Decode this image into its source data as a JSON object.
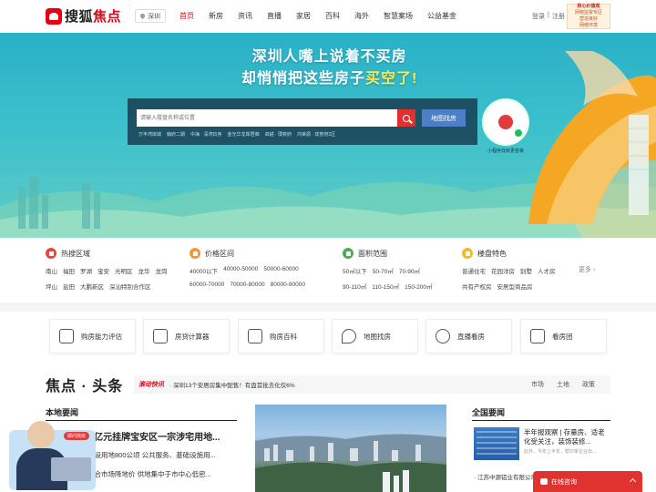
{
  "nav": {
    "logo_prefix": "搜狐",
    "logo_suffix": "焦点",
    "city": "深圳",
    "menu": [
      "首页",
      "新房",
      "资讯",
      "直播",
      "家居",
      "百科",
      "海外",
      "智慧案场",
      "公益基金"
    ],
    "active_menu": "首页",
    "login": "登录",
    "separator": "|",
    "register": "注册",
    "ad_badge_lines": [
      "核心价值观",
      "网络监督专区",
      "营造良好",
      "网络环境"
    ]
  },
  "banner": {
    "headline_line1": "深圳人嘴上说着不买房",
    "headline_line2_pre": "却悄悄把这些房子",
    "headline_line2_highlight": "买空了!",
    "search_placeholder": "请输入楼盘名称或位置",
    "map_button": "地图找房",
    "hot_tags": [
      "万丰湾岸城",
      "翰府二期",
      "中海 · 深湾玖序",
      "金光华龙岸君御",
      "卓越 · 璞奕府",
      "鸿荣源 · 珑誉府2区"
    ],
    "qr_caption": "小程序找房更容易"
  },
  "filters": [
    {
      "title": "热搜区域",
      "icon": "fire-icon",
      "color": "#e8473a",
      "rows": [
        [
          "南山",
          "福田",
          "罗湖",
          "宝安",
          "光明区",
          "龙华",
          "龙岗"
        ],
        [
          "坪山",
          "盐田",
          "大鹏新区",
          "深汕特别合作区"
        ]
      ]
    },
    {
      "title": "价格区间",
      "icon": "price-icon",
      "color": "#f39a2b",
      "rows": [
        [
          "40000以下",
          "40000-50000",
          "50000-60000"
        ],
        [
          "60000-70000",
          "70000-80000",
          "80000-90000"
        ]
      ]
    },
    {
      "title": "面积范围",
      "icon": "area-icon",
      "color": "#4caf50",
      "rows": [
        [
          "50㎡以下",
          "50-70㎡",
          "70-90㎡"
        ],
        [
          "90-110㎡",
          "110-150㎡",
          "150-200㎡"
        ]
      ]
    },
    {
      "title": "楼盘特色",
      "icon": "feature-icon",
      "color": "#f3b82b",
      "rows": [
        [
          "普通住宅",
          "花园洋房",
          "别墅",
          "人才房"
        ],
        [
          "共有产权房",
          "安居型商品房"
        ]
      ]
    }
  ],
  "filters_more": "更多 ›",
  "tools": [
    {
      "label": "购房能力评估",
      "icon": "house-check-icon"
    },
    {
      "label": "房贷计算器",
      "icon": "calculator-icon"
    },
    {
      "label": "购房百科",
      "icon": "book-icon"
    },
    {
      "label": "地图找房",
      "icon": "map-pin-icon"
    },
    {
      "label": "直播看房",
      "icon": "play-icon"
    },
    {
      "label": "看房团",
      "icon": "group-icon"
    }
  ],
  "news": {
    "title": "焦点 · 头条",
    "ticker_tag": "滚动快讯",
    "ticker_text": "· 深圳13个安居房集中配售！有盘首批去化仅6%",
    "ticker_tabs": [
      "市场",
      "土地",
      "政策"
    ],
    "local_title": "本地要闻",
    "local_lead": "55亿元挂牌宝安区一宗涉宅用地...",
    "local_items": [
      "建设用地800公顷 公共服务、基础设施用...",
      "综合市场降地价 供地集中于市中心低密..."
    ],
    "national_title": "全国要闻",
    "national_lead": "半年报观察 | 存量房、适老化受关注，装饰装修...",
    "national_meta": "此外，今年上半年，帮印家企业出...",
    "national_item": "· 江苏中源铝业有限公司..."
  },
  "advisor_badge": "顾问找房",
  "chat_label": "在线咨询"
}
